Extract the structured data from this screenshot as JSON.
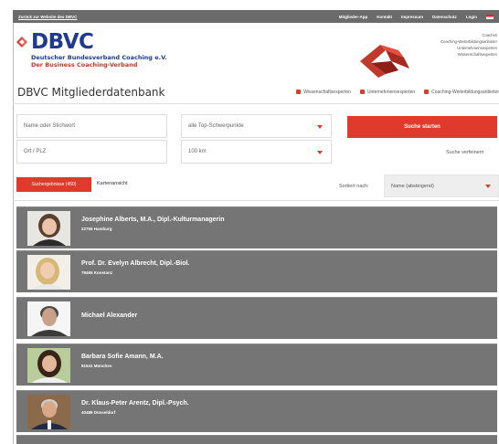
{
  "topbar": {
    "back_link": "Zurück zur Website des DBVC",
    "menu": [
      "Mitglieder-App",
      "Kontakt",
      "Impressum",
      "Datenschutz",
      "Login"
    ]
  },
  "header": {
    "logo_text": "DBVC",
    "logo_sub1": "Deutscher Bundesverband Coaching e.V.",
    "logo_sub2": "Der Business Coaching-Verband",
    "taglines": [
      "Coaches",
      "Coaching-Weiterbildungsanbieter",
      "Unternehmensexperten",
      "Wissenschaftsexperten"
    ]
  },
  "title": {
    "text": "DBVC Mitgliederdatenbank",
    "legend": [
      "Wissenschaftsexperten",
      "Unternehmensexperten",
      "Coaching-Weiterbildungsanbieter"
    ]
  },
  "form": {
    "name_placeholder": "Name oder Stichwort",
    "focus_value": "alle Top-Schwerpunkte",
    "location_placeholder": "Ort / PLZ",
    "radius_value": "100 km",
    "search_label": "Suche starten",
    "refine_label": "Suche verfeinern"
  },
  "tabs": {
    "results_label": "Suchergebnisse (450)",
    "map_label": "Kartenansicht",
    "sort_label": "Sortiert nach:",
    "sort_value": "Name (absteigend)"
  },
  "results": [
    {
      "name": "Josephine Alberts, M.A., Dipl.-Kulturmanagerin",
      "location": "22765 Hamburg"
    },
    {
      "name": "Prof. Dr. Evelyn Albrecht, Dipl.-Biol.",
      "location": "78465 Konstanz"
    },
    {
      "name": "Michael Alexander",
      "location": ""
    },
    {
      "name": "Barbara Sofie Amann, M.A.",
      "location": "81541 München"
    },
    {
      "name": "Dr. Klaus-Peter Arentz, Dipl.-Psych.",
      "location": "40489 Düsseldorf"
    }
  ],
  "colors": {
    "accent": "#e03a2c",
    "brand_blue": "#1f3a8f",
    "row_bg": "#757575"
  }
}
